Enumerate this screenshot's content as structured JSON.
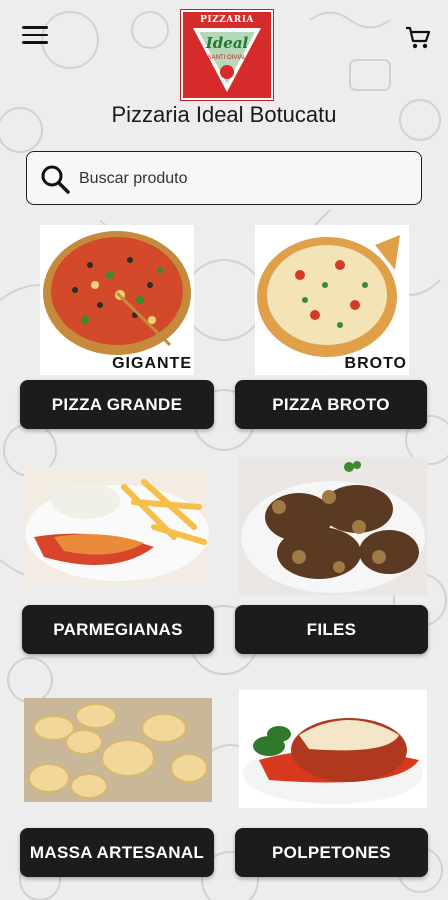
{
  "header": {
    "title": "Pizzaria Ideal Botucatu",
    "logo": {
      "line1": "PIZZARIA",
      "line2": "Ideal",
      "line3": "SANTI OIVIAL"
    },
    "menu_icon": "hamburger-menu-icon",
    "cart_icon": "shopping-cart-icon"
  },
  "search": {
    "placeholder": "Buscar produto",
    "icon": "search-icon"
  },
  "categories": [
    {
      "label": "PIZZA GRANDE",
      "image_caption": "GIGANTE"
    },
    {
      "label": "PIZZA BROTO",
      "image_caption": "BROTO"
    },
    {
      "label": "PARMEGIANAS",
      "image_caption": ""
    },
    {
      "label": "FILES",
      "image_caption": ""
    },
    {
      "label": "MASSA ARTESANAL",
      "image_caption": ""
    },
    {
      "label": "POLPETONES",
      "image_caption": ""
    }
  ],
  "colors": {
    "button_bg": "#1c1c1c",
    "button_text": "#ffffff",
    "logo_red": "#d62b2b",
    "background": "#ededed"
  }
}
